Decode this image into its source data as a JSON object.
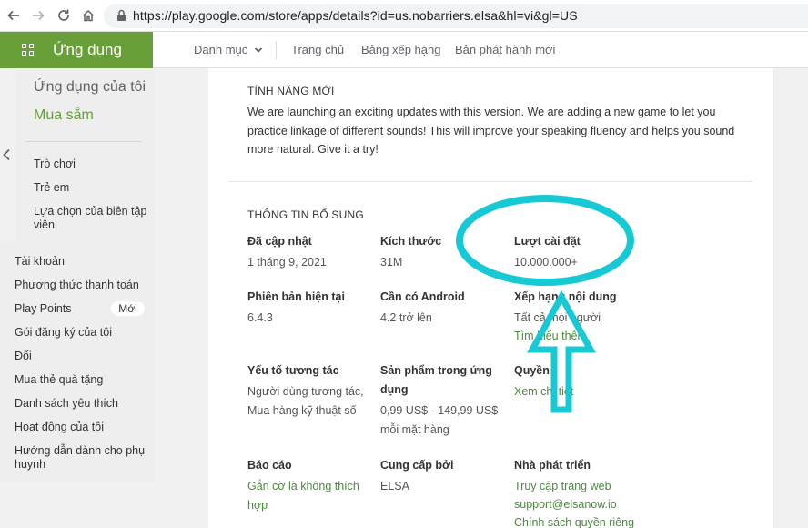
{
  "browser": {
    "url": "https://play.google.com/store/apps/details?id=us.nobarriers.elsa&hl=vi&gl=US"
  },
  "app_bar": {
    "section": "Ứng dụng",
    "categories": "Danh mục",
    "home": "Trang chủ",
    "charts": "Bảng xếp hạng",
    "new_releases": "Bản phát hành mới"
  },
  "sidebar": {
    "my_apps": "Ứng dụng của tôi",
    "shop": "Mua sắm",
    "sub": [
      "Trò chơi",
      "Trẻ em",
      "Lựa chọn của biên tập viên"
    ],
    "account": [
      "Tài khoản",
      "Phương thức thanh toán",
      "Play Points",
      "Gói đăng ký của tôi",
      "Đổi",
      "Mua thẻ quà tặng",
      "Danh sách yêu thích",
      "Hoạt động của tôi",
      "Hướng dẫn dành cho phụ huynh"
    ],
    "badge_new": "Mới"
  },
  "whats_new": {
    "title": "TÍNH NĂNG MỚI",
    "text": "We are launching an exciting updates with this version. We are adding a new game to let you practice linkage of different sounds! This will improve your speaking fluency and helps you sound more natural. Give it a try!"
  },
  "additional_info": {
    "title": "THÔNG TIN BỔ SUNG",
    "updated_label": "Đã cập nhật",
    "updated_value": "1 tháng 9, 2021",
    "size_label": "Kích thước",
    "size_value": "31M",
    "installs_label": "Lượt cài đặt",
    "installs_value": "10.000.000+",
    "version_label": "Phiên bản hiện tại",
    "version_value": "6.4.3",
    "android_label": "Cần có Android",
    "android_value": "4.2 trở lên",
    "rating_label": "Xếp hạng nội dung",
    "rating_value": "Tất cả mọi người",
    "rating_link": "Tìm hiểu thêm",
    "interactive_label": "Yếu tố tương tác",
    "interactive_value": "Người dùng tương tác, Mua hàng kỹ thuật số",
    "inapp_label": "Sản phẩm trong ứng dụng",
    "inapp_value": "0,99 US$ - 149,99 US$ mỗi mặt hàng",
    "permissions_label": "Quyền",
    "permissions_link": "Xem chi tiết",
    "report_label": "Báo cáo",
    "report_link": "Gắn cờ là không thích hợp",
    "offered_label": "Cung cấp bởi",
    "offered_value": "ELSA",
    "developer_label": "Nhà phát triển",
    "dev_website": "Truy cập trang web",
    "dev_email": "support@elsanow.io",
    "dev_privacy": "Chính sách quyền riêng"
  },
  "colors": {
    "brand_green": "#689f38",
    "link_green": "#4b8a3e",
    "annotation_cyan": "#17c9d4"
  }
}
